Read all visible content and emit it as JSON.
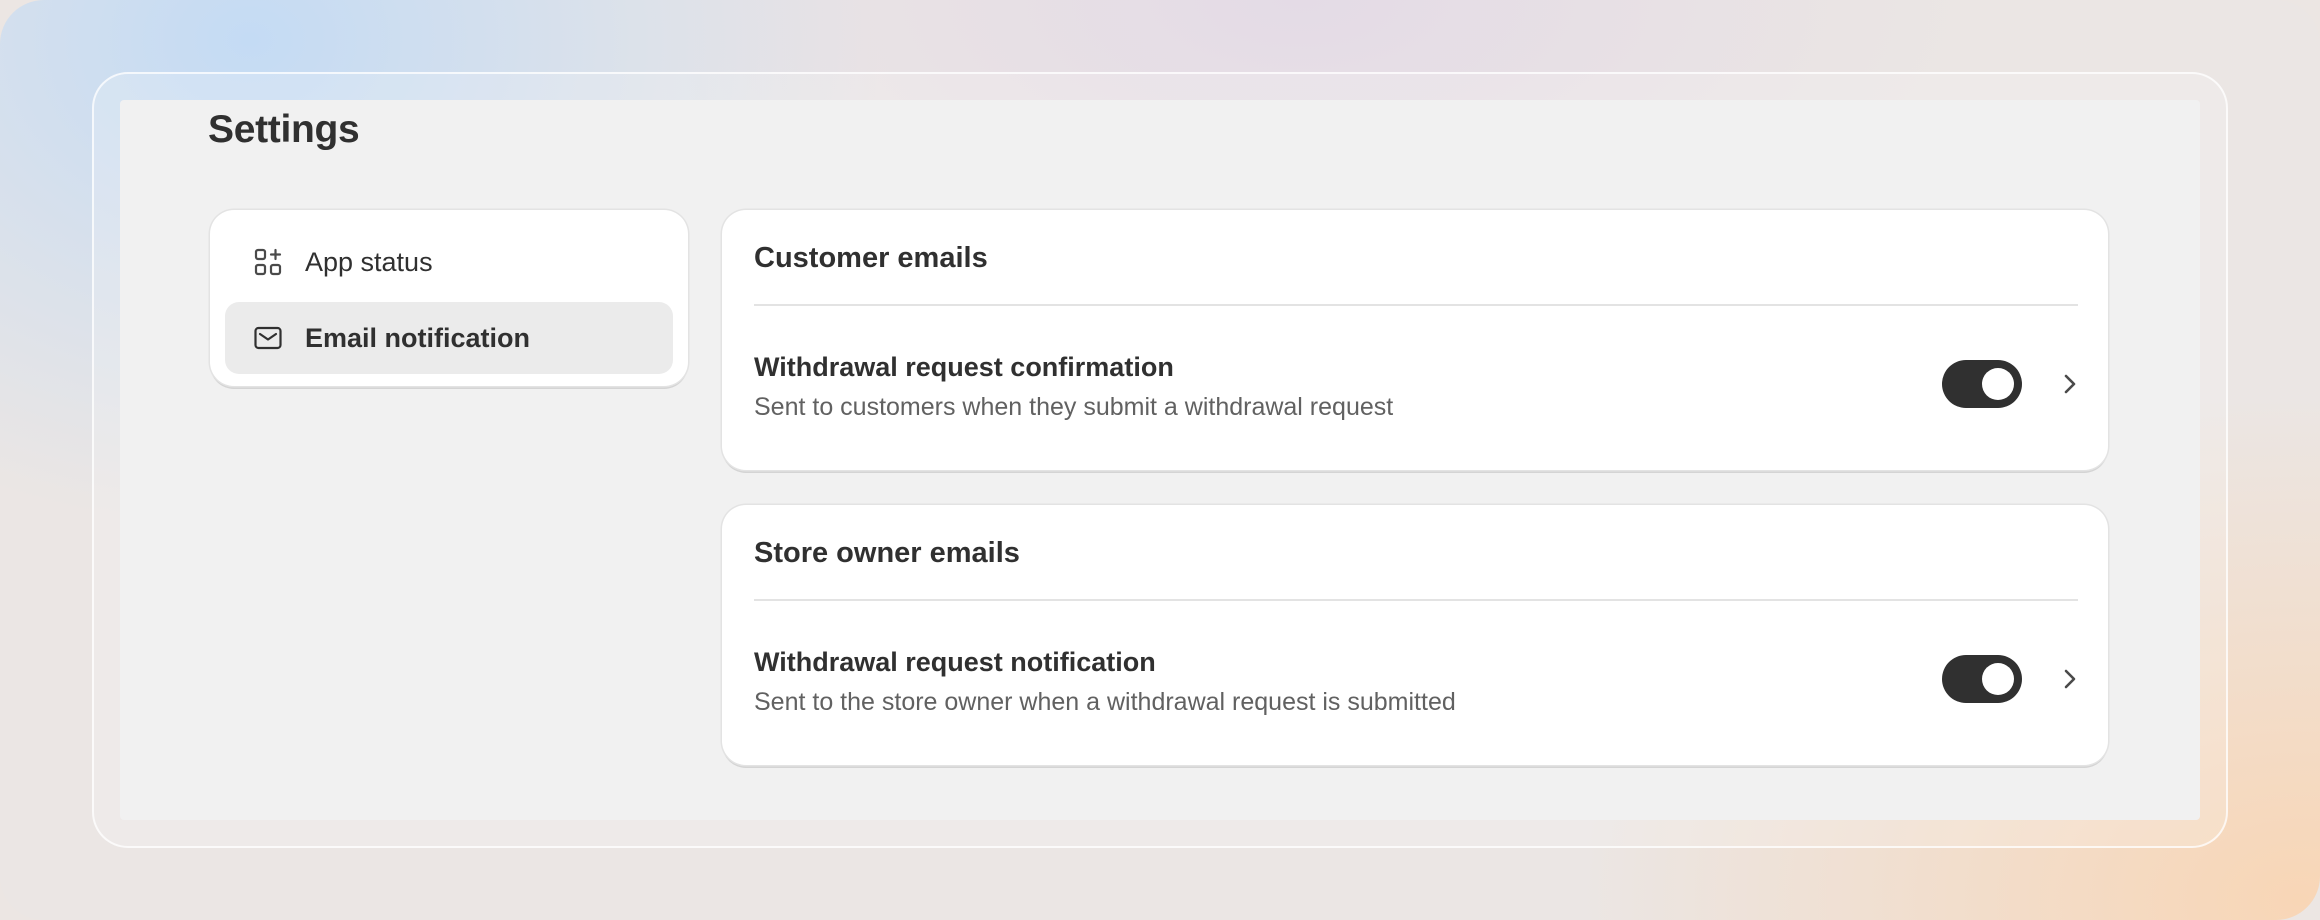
{
  "page": {
    "title": "Settings"
  },
  "sidebar": {
    "items": [
      {
        "label": "App status",
        "icon": "apps-add-icon",
        "active": false
      },
      {
        "label": "Email notification",
        "icon": "envelope-icon",
        "active": true
      }
    ]
  },
  "sections": [
    {
      "title": "Customer emails",
      "rows": [
        {
          "title": "Withdrawal request confirmation",
          "description": "Sent to customers when they submit a withdrawal request",
          "enabled": true
        }
      ]
    },
    {
      "title": "Store owner emails",
      "rows": [
        {
          "title": "Withdrawal request notification",
          "description": "Sent to the store owner when a withdrawal request is submitted",
          "enabled": true
        }
      ]
    }
  ],
  "colors": {
    "text_primary": "#303030",
    "text_secondary": "#616161",
    "toggle_on": "#303030",
    "surface": "#ffffff",
    "app_background": "#f1f1f1",
    "active_nav_background": "#ebebeb"
  }
}
